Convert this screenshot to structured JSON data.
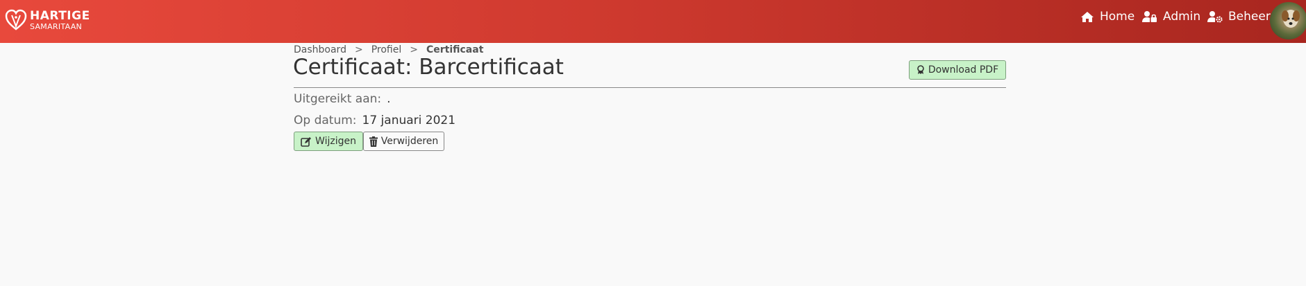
{
  "brand": {
    "line1": "HARTIGE",
    "line2": "SAMARITAAN"
  },
  "nav": {
    "home": "Home",
    "admin": "Admin",
    "beheer": "Beheer"
  },
  "breadcrumb": {
    "items": [
      "Dashboard",
      "Profiel",
      "Certificaat"
    ],
    "separator": ">"
  },
  "page": {
    "title": "Certificaat: Barcertificaat",
    "download_label": "Download PDF"
  },
  "details": {
    "issued_label": "Uitgereikt aan:",
    "issued_value": ".",
    "date_label": "Op datum:",
    "date_value": "17 januari 2021"
  },
  "actions": {
    "edit_label": "Wijzigen",
    "delete_label": "Verwijderen"
  },
  "colors": {
    "navbar_start": "#e8493c",
    "navbar_end": "#a8261f",
    "success_bg": "#c8f2c8"
  },
  "icons": {
    "brand": "heart-logo-icon",
    "home": "home-icon",
    "admin": "user-lock-icon",
    "beheer": "user-cog-icon",
    "download": "award-icon",
    "edit": "edit-icon",
    "delete": "trash-icon"
  }
}
